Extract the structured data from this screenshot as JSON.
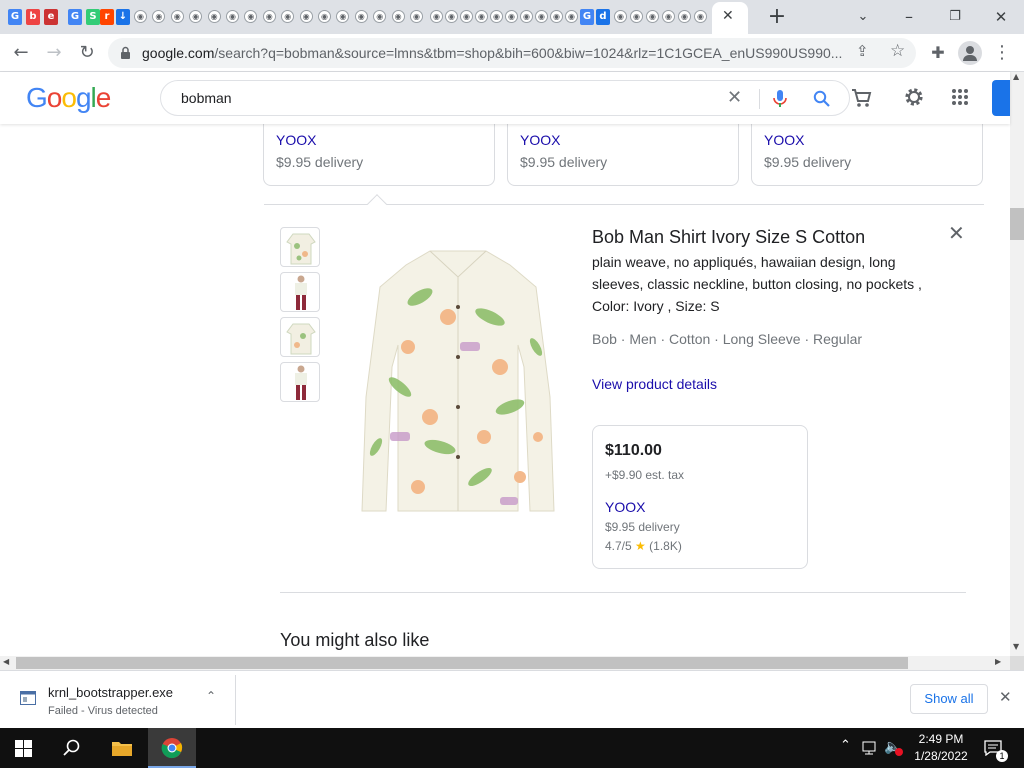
{
  "browser": {
    "tab_close": "✕",
    "new_tab": "+",
    "url_host": "google.com",
    "url_rest": "/search?q=bobman&source=lmns&tbm=shop&bih=600&biw=1024&rlz=1C1GCEA_enUS990US990..."
  },
  "google": {
    "logo": [
      "G",
      "o",
      "o",
      "g",
      "l",
      "e"
    ],
    "search_value": "bobman"
  },
  "top_cards": [
    {
      "seller": "YOOX",
      "delivery": "$9.95 delivery"
    },
    {
      "seller": "YOOX",
      "delivery": "$9.95 delivery"
    },
    {
      "seller": "YOOX",
      "delivery": "$9.95 delivery"
    }
  ],
  "product": {
    "title": "Bob Man Shirt Ivory Size S Cotton",
    "description": "plain weave, no appliqués, hawaiian design, long sleeves, classic neckline, button closing, no pockets , Color: Ivory , Size: S",
    "tags": "Bob · Men · Cotton · Long Sleeve · Regular",
    "view_details": "View product details",
    "offer": {
      "price": "$110.00",
      "tax": "+$9.90 est. tax",
      "seller": "YOOX",
      "delivery": "$9.95 delivery",
      "rating": "4.7/5",
      "reviews": "(1.8K)"
    }
  },
  "section_heading": "You might also like",
  "download": {
    "filename": "krnl_bootstrapper.exe",
    "status": "Failed - Virus detected",
    "show_all": "Show all"
  },
  "taskbar": {
    "time": "2:49 PM",
    "date": "1/28/2022",
    "notification_count": "1"
  },
  "colors": {
    "link": "#1a0dab",
    "accent_blue": "#1a73e8",
    "tabstrip": "#dee1e6"
  }
}
